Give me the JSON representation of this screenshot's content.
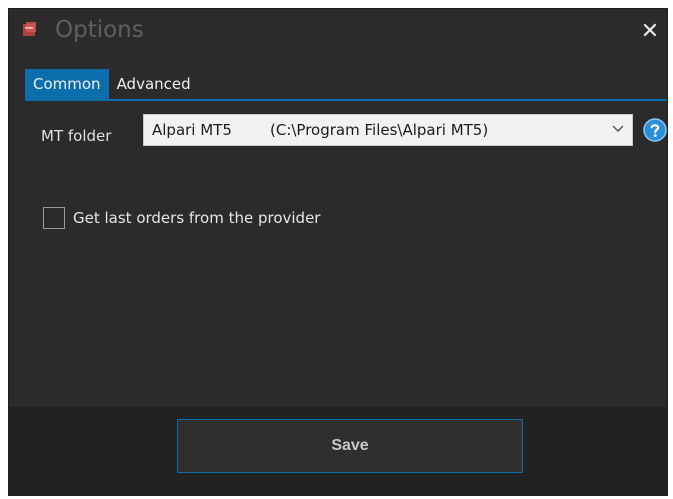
{
  "window": {
    "title": "Options",
    "close_symbol": "✕",
    "icon": "app-window-icon"
  },
  "tabs": [
    {
      "label": "Common",
      "active": true
    },
    {
      "label": "Advanced",
      "active": false
    }
  ],
  "common": {
    "mt_folder_label": "MT folder",
    "mt_folder_select": {
      "selected_name": "Alpari MT5",
      "selected_path": "(C:\\Program Files\\Alpari MT5)",
      "icon": "chevron-down-icon"
    },
    "help_icon": "help-icon",
    "checkbox": {
      "label": "Get last orders from the provider",
      "checked": false
    }
  },
  "footer": {
    "save_label": "Save"
  },
  "colors": {
    "accent": "#0d6eae",
    "window_bg": "#2b2b2b",
    "footer_bg": "#222222",
    "help_blue": "#2a8fd8"
  }
}
